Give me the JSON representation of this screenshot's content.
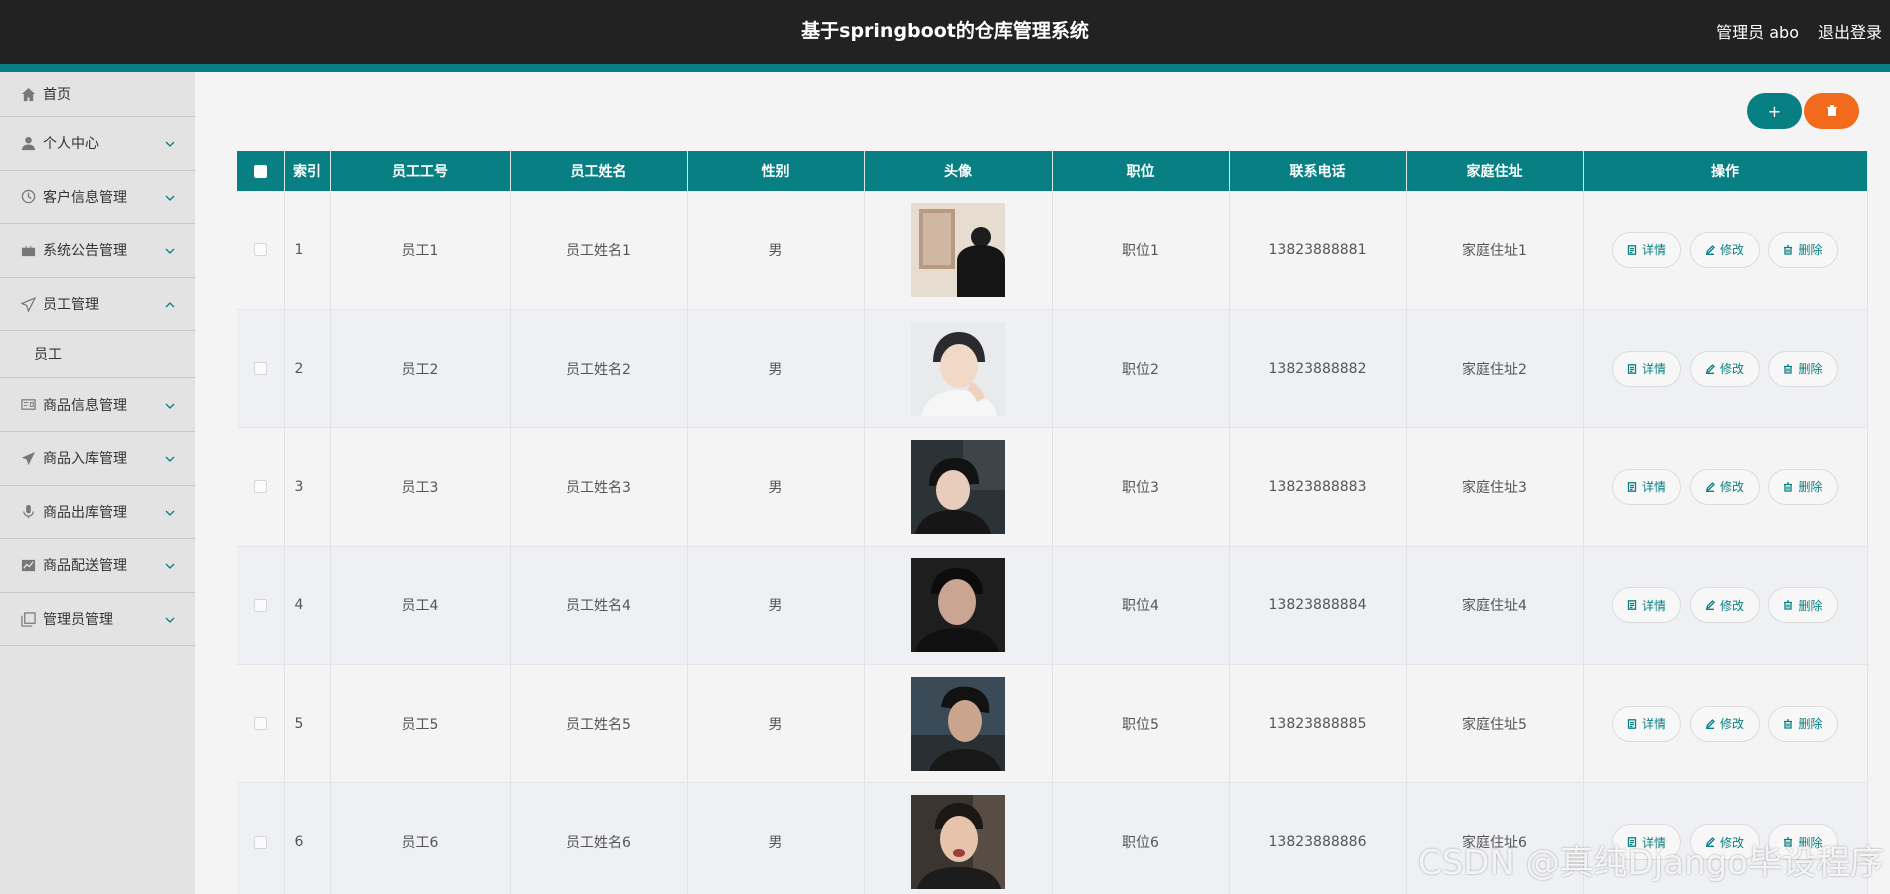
{
  "header": {
    "title": "基于springboot的仓库管理系统",
    "user": "管理员 abo",
    "logout": "退出登录"
  },
  "sidebar": {
    "items": [
      {
        "label": "首页",
        "icon": "home-icon",
        "expandable": false
      },
      {
        "label": "个人中心",
        "icon": "user-icon",
        "expandable": true,
        "expanded": false
      },
      {
        "label": "客户信息管理",
        "icon": "clock-icon",
        "expandable": true,
        "expanded": false
      },
      {
        "label": "系统公告管理",
        "icon": "briefcase-icon",
        "expandable": true,
        "expanded": false
      },
      {
        "label": "员工管理",
        "icon": "send-icon",
        "expandable": true,
        "expanded": true,
        "children": [
          "员工"
        ]
      },
      {
        "label": "商品信息管理",
        "icon": "card-icon",
        "expandable": true,
        "expanded": false
      },
      {
        "label": "商品入库管理",
        "icon": "plane-icon",
        "expandable": true,
        "expanded": false
      },
      {
        "label": "商品出库管理",
        "icon": "mic-icon",
        "expandable": true,
        "expanded": false
      },
      {
        "label": "商品配送管理",
        "icon": "chart-icon",
        "expandable": true,
        "expanded": false
      },
      {
        "label": "管理员管理",
        "icon": "copy-icon",
        "expandable": true,
        "expanded": false
      }
    ],
    "accent": "#087f82"
  },
  "toolbar": {
    "add_label": "+",
    "add_color": "#087f82",
    "delete_icon": "trash-icon",
    "delete_color": "#f26a1b"
  },
  "table": {
    "columns": [
      "索引",
      "员工工号",
      "员工姓名",
      "性别",
      "头像",
      "职位",
      "联系电话",
      "家庭住址",
      "操作"
    ],
    "actions": {
      "detail": "详情",
      "edit": "修改",
      "delete": "删除"
    },
    "rows": [
      {
        "index": "1",
        "id": "员工1",
        "name": "员工姓名1",
        "gender": "男",
        "position": "职位1",
        "phone": "13823888881",
        "address": "家庭住址1"
      },
      {
        "index": "2",
        "id": "员工2",
        "name": "员工姓名2",
        "gender": "男",
        "position": "职位2",
        "phone": "13823888882",
        "address": "家庭住址2"
      },
      {
        "index": "3",
        "id": "员工3",
        "name": "员工姓名3",
        "gender": "男",
        "position": "职位3",
        "phone": "13823888883",
        "address": "家庭住址3"
      },
      {
        "index": "4",
        "id": "员工4",
        "name": "员工姓名4",
        "gender": "男",
        "position": "职位4",
        "phone": "13823888884",
        "address": "家庭住址4"
      },
      {
        "index": "5",
        "id": "员工5",
        "name": "员工姓名5",
        "gender": "男",
        "position": "职位5",
        "phone": "13823888885",
        "address": "家庭住址5"
      },
      {
        "index": "6",
        "id": "员工6",
        "name": "员工姓名6",
        "gender": "男",
        "position": "职位6",
        "phone": "13823888886",
        "address": "家庭住址6"
      }
    ]
  },
  "watermark": "CSDN @真纯Django毕设程序"
}
